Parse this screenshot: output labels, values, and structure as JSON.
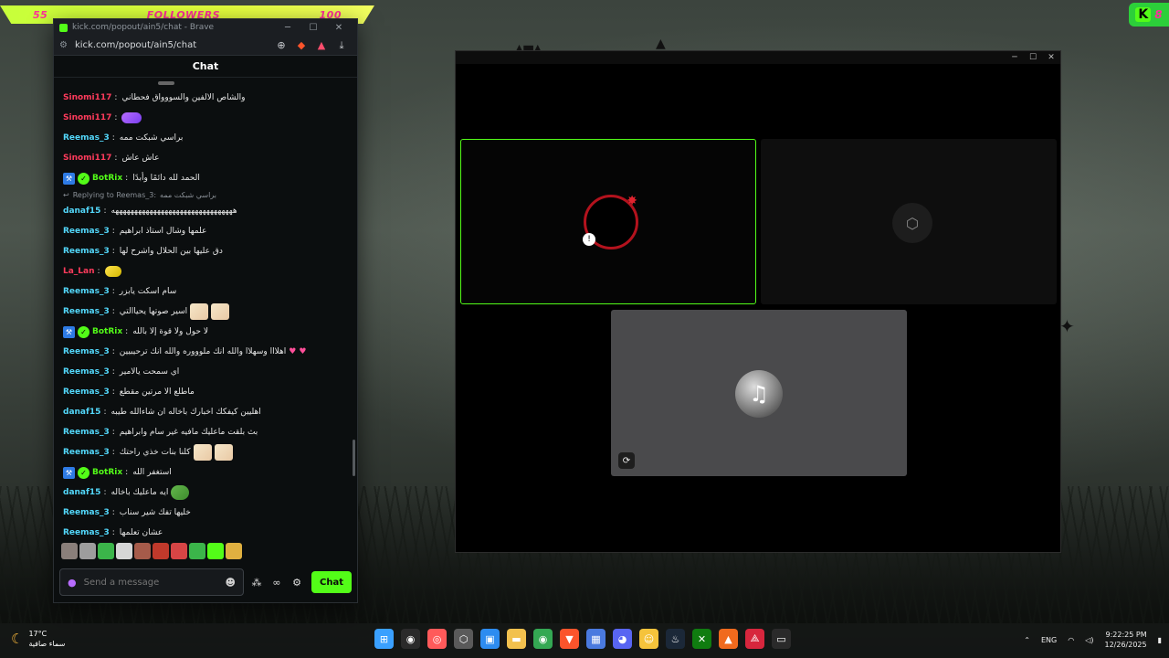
{
  "overlay": {
    "goal_current": "55",
    "goal_label": "FOLLOWERS",
    "goal_target": "100",
    "kick_letter": "K",
    "kick_count": "8"
  },
  "browser": {
    "tab_title": "kick.com/popout/ain5/chat - Brave",
    "url": "kick.com/popout/ain5/chat",
    "chat_title": "Chat"
  },
  "chat": {
    "messages": [
      {
        "user": "Sinomi117",
        "color": "#ff3b5c",
        "text": "والشاص الالفين والسووواق فحطاني"
      },
      {
        "user": "Sinomi117",
        "color": "#ff3b5c",
        "text": "",
        "emote": "purple"
      },
      {
        "user": "Reemas_3",
        "color": "#53d8fb",
        "text": "براسي شبكت ممه"
      },
      {
        "user": "Sinomi117",
        "color": "#ff3b5c",
        "text": "عاش عاش"
      },
      {
        "user": "BotRix",
        "color": "#53fc18",
        "text": "الحمد لله دائمًا وأبدًا",
        "badges": true
      },
      {
        "reply_to": "Replying to Reemas_3:",
        "reply_text": "براسي شبكت ممه"
      },
      {
        "user": "danaf15",
        "color": "#53d8fb",
        "text": "ههههههههههههههههههههههههههههههههه"
      },
      {
        "user": "Reemas_3",
        "color": "#53d8fb",
        "text": "علمها وشال استاذ ابراهيم"
      },
      {
        "user": "Reemas_3",
        "color": "#53d8fb",
        "text": "دق عليها بين الحلال واشرح لها"
      },
      {
        "user": "La_Lan",
        "color": "#ff3b5c",
        "text": "",
        "emote": "yellow"
      },
      {
        "user": "Reemas_3",
        "color": "#53d8fb",
        "text": "سام اسكت يابزر"
      },
      {
        "user": "Reemas_3",
        "color": "#53d8fb",
        "text": "اسير صوتها يحياالتي",
        "emote": "anime2"
      },
      {
        "user": "BotRix",
        "color": "#53fc18",
        "text": "لا حول ولا قوة إلا بالله",
        "badges": true
      },
      {
        "user": "Reemas_3",
        "color": "#53d8fb",
        "text": "اهلااا وسهلاا والله انك ملوووره والله انك ترحيبيين",
        "hearts": true
      },
      {
        "user": "Reemas_3",
        "color": "#53d8fb",
        "text": "اي سمحت يالامير"
      },
      {
        "user": "Reemas_3",
        "color": "#53d8fb",
        "text": "ماطلع الا مرتين مقطع"
      },
      {
        "user": "danaf15",
        "color": "#53d8fb",
        "text": "اهليين كيفكك اخبارك باخاله ان شاءالله طيبه"
      },
      {
        "user": "Reemas_3",
        "color": "#53d8fb",
        "text": "بث بلقت ماعليك مافيه غير سام وابراهيم"
      },
      {
        "user": "Reemas_3",
        "color": "#53d8fb",
        "text": "كلنا بنات خذي راحتك",
        "emote": "anime2"
      },
      {
        "user": "BotRix",
        "color": "#53fc18",
        "text": "استغفر الله",
        "badges": true
      },
      {
        "user": "danaf15",
        "color": "#53d8fb",
        "text": "ايه ماعليك باخاله",
        "emote": "pepe"
      },
      {
        "user": "Reemas_3",
        "color": "#53d8fb",
        "text": "خليها تفك شير سناب"
      },
      {
        "user": "Reemas_3",
        "color": "#53d8fb",
        "text": "عشان تعلمها"
      }
    ],
    "input_placeholder": "Send a message",
    "send_label": "Chat",
    "emote_colors": [
      "#8a7f7a",
      "#9d9d9d",
      "#3bb54a",
      "#d6d6d6",
      "#a65b4a",
      "#c0392b",
      "#d64545",
      "#3bb54a",
      "#53fc18",
      "#e0b040"
    ]
  },
  "taskbar": {
    "temperature": "17°C",
    "weather_text": "سماء صافية",
    "language": "ENG",
    "time": "9:22:25 PM",
    "date": "12/26/2025",
    "apps": [
      {
        "name": "windows-start",
        "glyph": "⊞",
        "color": "#3aa0ff"
      },
      {
        "name": "obs",
        "glyph": "◉",
        "color": "#2a2a2a"
      },
      {
        "name": "color-app",
        "glyph": "◎",
        "color": "#ff5a5a"
      },
      {
        "name": "cube-app",
        "glyph": "⬡",
        "color": "#5a5a5a"
      },
      {
        "name": "blue-app",
        "glyph": "▣",
        "color": "#2d8cf0"
      },
      {
        "name": "file-explorer",
        "glyph": "▬",
        "color": "#f2c14e"
      },
      {
        "name": "chrome",
        "glyph": "◉",
        "color": "#34a853"
      },
      {
        "name": "brave",
        "glyph": "▼",
        "color": "#fb542b"
      },
      {
        "name": "store",
        "glyph": "▦",
        "color": "#4a7adf"
      },
      {
        "name": "discord",
        "glyph": "◕",
        "color": "#5865f2"
      },
      {
        "name": "emoji-app",
        "glyph": "☺",
        "color": "#f5c33b"
      },
      {
        "name": "steam",
        "glyph": "♨",
        "color": "#1b2838"
      },
      {
        "name": "xbox",
        "glyph": "✕",
        "color": "#107c10"
      },
      {
        "name": "orange-app",
        "glyph": "▲",
        "color": "#f06a1d"
      },
      {
        "name": "red-app",
        "glyph": "⟁",
        "color": "#d7263d"
      },
      {
        "name": "terminal",
        "glyph": "▭",
        "color": "#2a2a2a"
      }
    ]
  }
}
